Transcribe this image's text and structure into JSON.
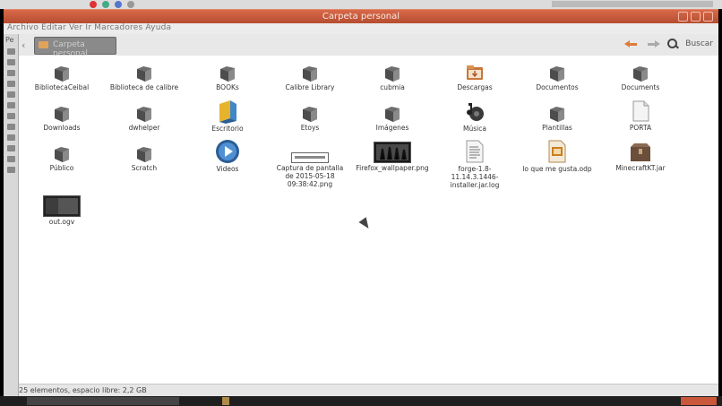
{
  "window": {
    "title": "Carpeta personal"
  },
  "menubar": {
    "text": "Archivo  Editar  Ver  Ir  Marcadores  Ayuda"
  },
  "toolbar": {
    "location": "Carpeta personal",
    "search_label": "Buscar"
  },
  "sidepanel": {
    "label": "Pe"
  },
  "files": [
    {
      "label": "BibliotecaCeibal",
      "icon": "folder"
    },
    {
      "label": "Biblioteca de calibre",
      "icon": "folder"
    },
    {
      "label": "BOOKs",
      "icon": "folder"
    },
    {
      "label": "Calibre Library",
      "icon": "folder"
    },
    {
      "label": "cubmia",
      "icon": "folder"
    },
    {
      "label": "Descargas",
      "icon": "downloads-folder"
    },
    {
      "label": "Documentos",
      "icon": "folder"
    },
    {
      "label": "Documents",
      "icon": "folder"
    },
    {
      "label": "Downloads",
      "icon": "folder"
    },
    {
      "label": "dwhelper",
      "icon": "folder"
    },
    {
      "label": "Escritorio",
      "icon": "desktop-folder"
    },
    {
      "label": "Etoys",
      "icon": "folder"
    },
    {
      "label": "Imágenes",
      "icon": "folder"
    },
    {
      "label": "Música",
      "icon": "music-folder"
    },
    {
      "label": "Plantillas",
      "icon": "folder"
    },
    {
      "label": "PORTA",
      "icon": "file"
    },
    {
      "label": "Público",
      "icon": "folder"
    },
    {
      "label": "Scratch",
      "icon": "folder"
    },
    {
      "label": "Videos",
      "icon": "video-folder"
    },
    {
      "label": "Captura de pantalla de 2015-05-18 09:38:42.png",
      "icon": "screenshot-image",
      "lines": [
        "Captura de pantalla",
        "de 2015-05-18",
        "09:38:42.png"
      ]
    },
    {
      "label": "Firefox_wallpaper.png",
      "icon": "image-thumbnail"
    },
    {
      "label": "forge-1.8-11.14.3.1446-installer.jar.log",
      "icon": "text-file",
      "lines": [
        "forge-1.8-",
        "11.14.3.1446-",
        "installer.jar.log"
      ]
    },
    {
      "label": "lo que me gusta.odp",
      "icon": "presentation-file"
    },
    {
      "label": "MinecraftKT.jar",
      "icon": "archive-file"
    },
    {
      "label": "out.ogv",
      "icon": "video-thumbnail"
    }
  ],
  "status": {
    "text": "25 elementos, espacio libre: 2,2 GB"
  },
  "colors": {
    "titlebar": "#c9583a",
    "folder": "#6e6e6e",
    "accent_orange": "#e07b3b"
  }
}
